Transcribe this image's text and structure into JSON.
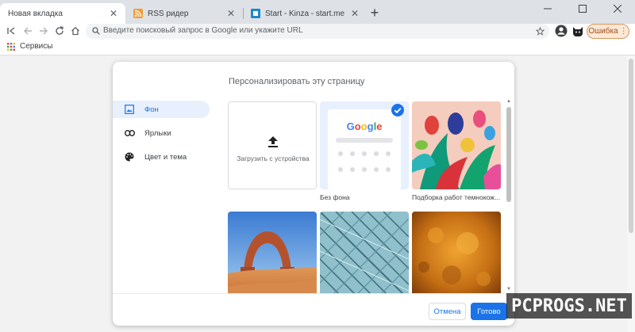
{
  "tabs": [
    {
      "title": "Новая вкладка",
      "active": true,
      "favicon": "blank-page-icon"
    },
    {
      "title": "RSS ридер",
      "active": false,
      "favicon": "rss-icon"
    },
    {
      "title": "Start - Kinza - start.me",
      "active": false,
      "favicon": "startme-icon"
    }
  ],
  "toolbar": {
    "address_placeholder": "Введите поисковый запрос в Google или укажите URL",
    "error_button_label": "Ошибка"
  },
  "bookmarks": {
    "apps_label": "Сервисы"
  },
  "dialog": {
    "title": "Персонализировать эту страницу",
    "menu": [
      {
        "label": "Фон",
        "icon": "image-icon",
        "selected": true
      },
      {
        "label": "Ярлыки",
        "icon": "link-icon",
        "selected": false
      },
      {
        "label": "Цвет и тема",
        "icon": "palette-icon",
        "selected": false
      }
    ],
    "tiles": [
      {
        "kind": "upload",
        "label": "Загрузить с устройства",
        "caption": ""
      },
      {
        "kind": "no-background",
        "caption": "Без фона",
        "selected": true
      },
      {
        "kind": "image",
        "caption": "Подборка работ темнокож..."
      },
      {
        "kind": "image",
        "caption": ""
      },
      {
        "kind": "image",
        "caption": ""
      },
      {
        "kind": "image",
        "caption": ""
      }
    ],
    "preview_logo": "Google",
    "cancel_label": "Отмена",
    "done_label": "Готово"
  },
  "watermark": "PCPROGS.NET",
  "colors": {
    "accent": "#1a73e8",
    "tabstrip": "#dee1e6",
    "error": "#d9965b"
  }
}
